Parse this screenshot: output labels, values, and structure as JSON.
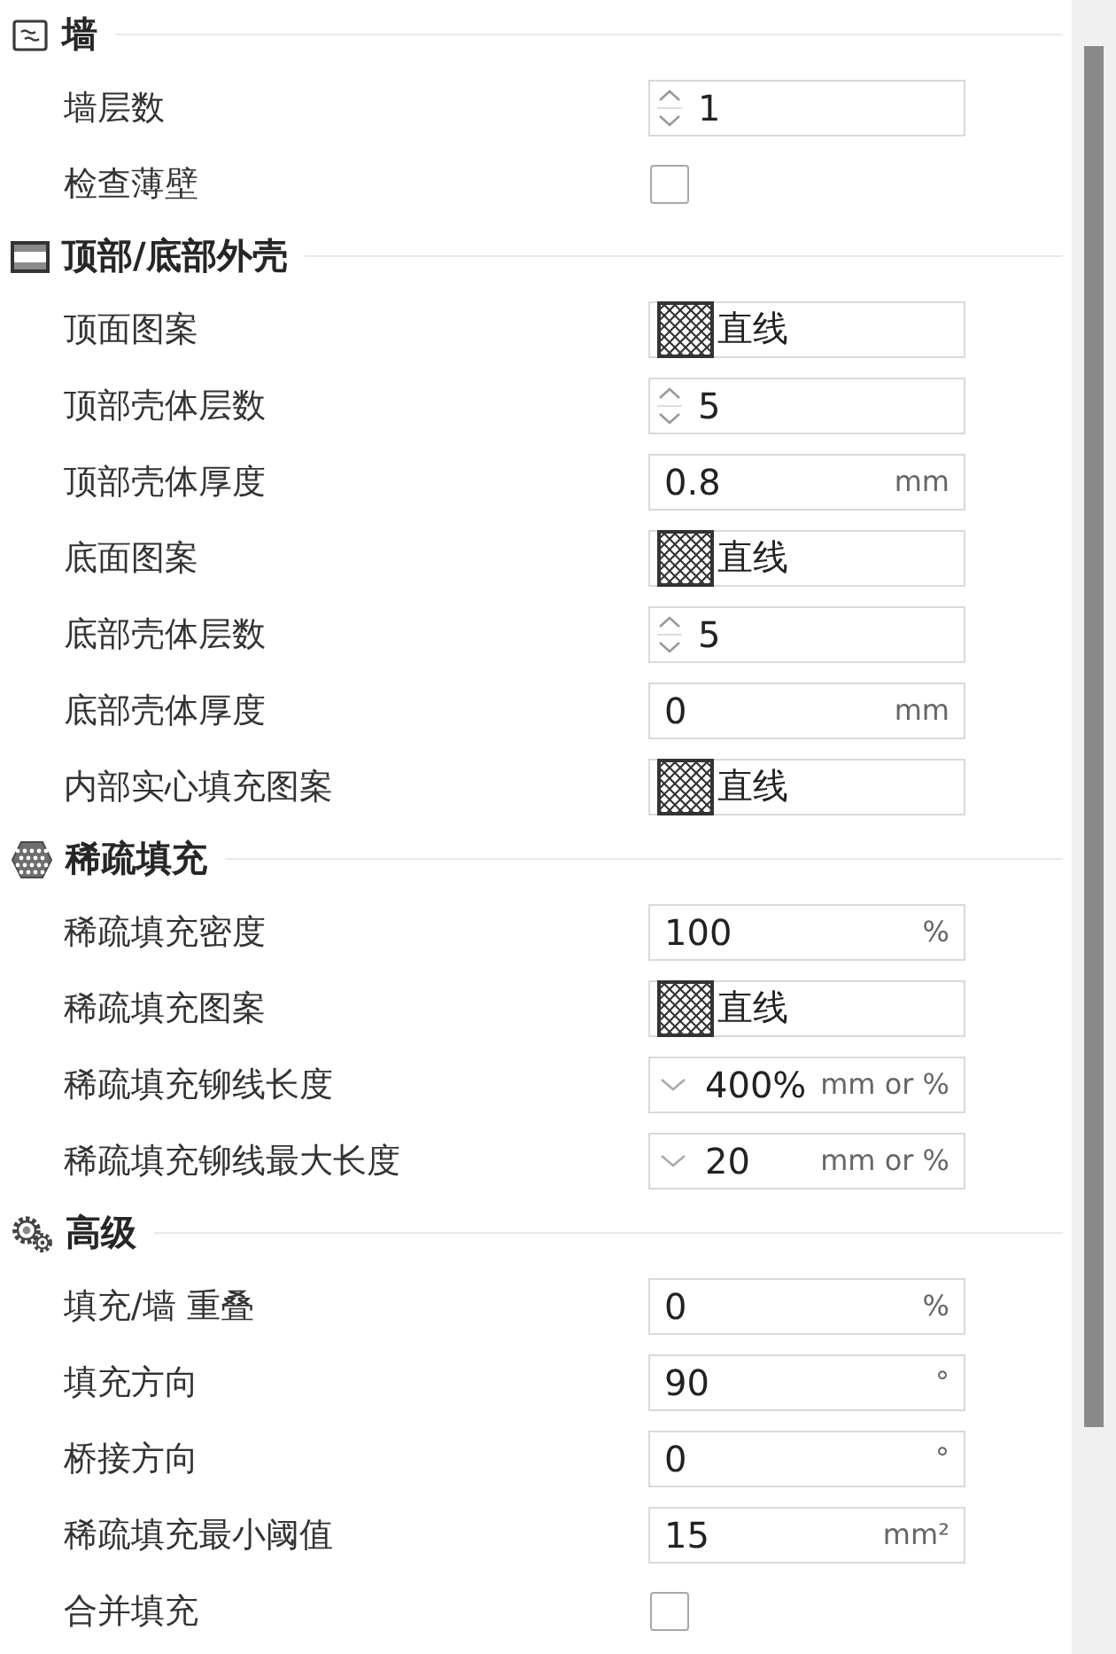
{
  "sections": [
    {
      "title": "墙",
      "rows": [
        {
          "label": "墙层数",
          "kind": "spin",
          "value": "1"
        },
        {
          "label": "检查薄壁",
          "kind": "checkbox",
          "checked": false
        }
      ]
    },
    {
      "title": "顶部/底部外壳",
      "rows": [
        {
          "label": "顶面图案",
          "kind": "pattern",
          "value": "直线"
        },
        {
          "label": "顶部壳体层数",
          "kind": "spin",
          "value": "5"
        },
        {
          "label": "顶部壳体厚度",
          "kind": "number",
          "value": "0.8",
          "unit": "mm"
        },
        {
          "label": "底面图案",
          "kind": "pattern",
          "value": "直线"
        },
        {
          "label": "底部壳体层数",
          "kind": "spin",
          "value": "5"
        },
        {
          "label": "底部壳体厚度",
          "kind": "number",
          "value": "0",
          "unit": "mm"
        },
        {
          "label": "内部实心填充图案",
          "kind": "pattern",
          "value": "直线"
        }
      ]
    },
    {
      "title": "稀疏填充",
      "rows": [
        {
          "label": "稀疏填充密度",
          "kind": "number",
          "value": "100",
          "unit": "%"
        },
        {
          "label": "稀疏填充图案",
          "kind": "pattern",
          "value": "直线"
        },
        {
          "label": "稀疏填充铆线长度",
          "kind": "combo",
          "value": "400%",
          "unit": "mm or %"
        },
        {
          "label": "稀疏填充铆线最大长度",
          "kind": "combo",
          "value": "20",
          "unit": "mm or %"
        }
      ]
    },
    {
      "title": "高级",
      "rows": [
        {
          "label": "填充/墙 重叠",
          "kind": "number",
          "value": "0",
          "unit": "%"
        },
        {
          "label": "填充方向",
          "kind": "number",
          "value": "90",
          "unit": "°"
        },
        {
          "label": "桥接方向",
          "kind": "number",
          "value": "0",
          "unit": "°"
        },
        {
          "label": "稀疏填充最小阈值",
          "kind": "number",
          "value": "15",
          "unit": "mm²"
        },
        {
          "label": "合并填充",
          "kind": "checkbox",
          "checked": false
        }
      ]
    }
  ]
}
